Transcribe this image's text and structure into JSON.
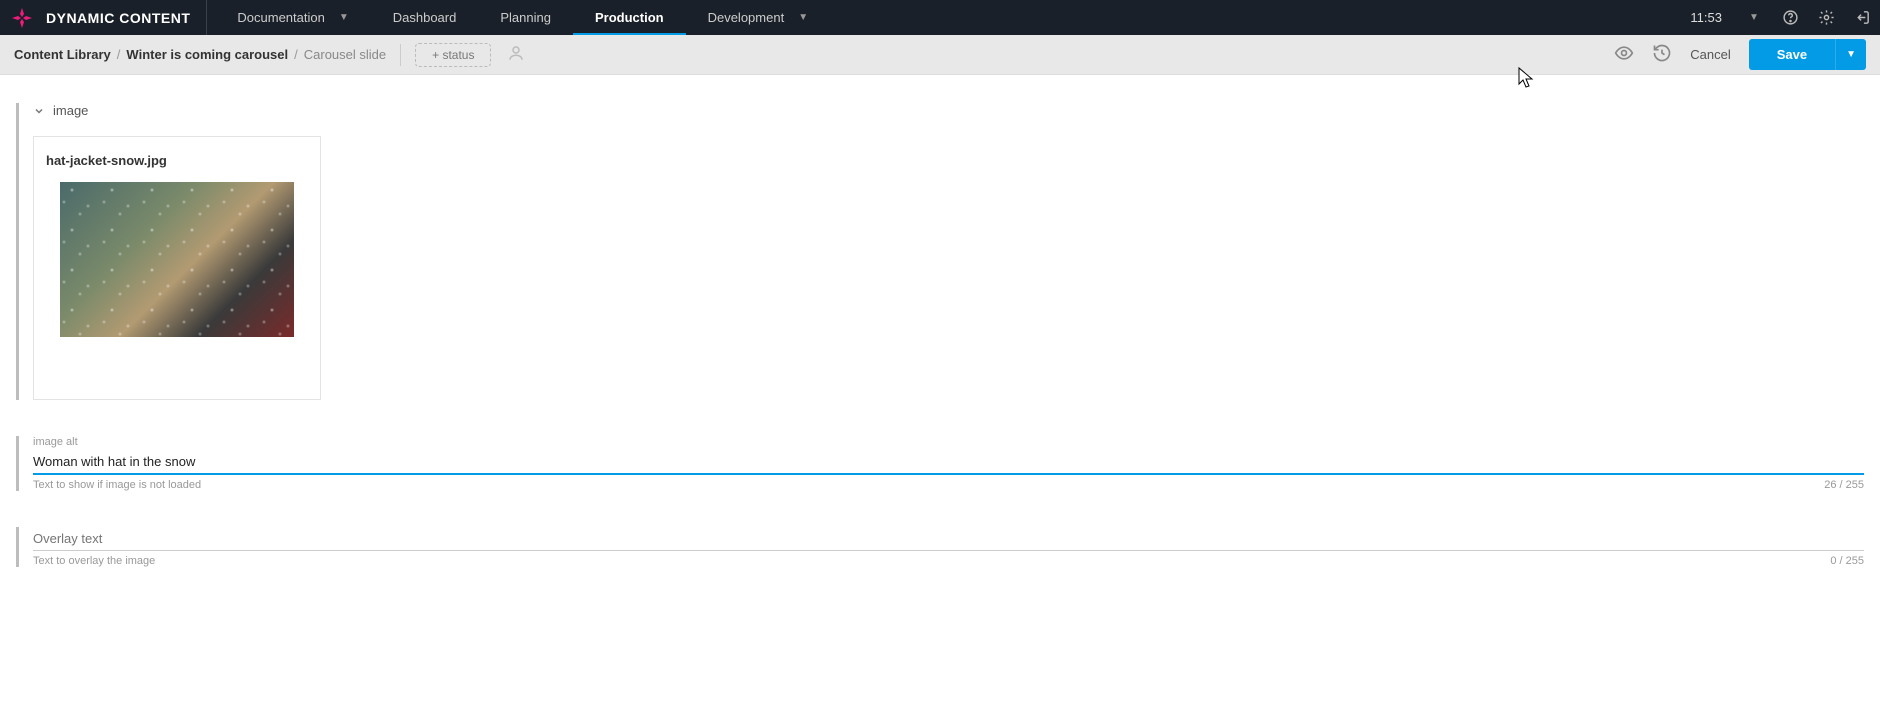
{
  "brand": "DYNAMIC CONTENT",
  "nav": {
    "documentation": "Documentation",
    "dashboard": "Dashboard",
    "planning": "Planning",
    "production": "Production",
    "development": "Development"
  },
  "clock": "11:53",
  "breadcrumb": {
    "root": "Content Library",
    "mid": "Winter is coming carousel",
    "leaf": "Carousel slide"
  },
  "status_button": "+ status",
  "actions": {
    "cancel": "Cancel",
    "save": "Save"
  },
  "sections": {
    "image": {
      "title": "image",
      "filename": "hat-jacket-snow.jpg"
    },
    "alt": {
      "label": "image alt",
      "value": "Woman with hat in the snow",
      "help": "Text to show if image is not loaded",
      "count": "26 / 255"
    },
    "overlay": {
      "placeholder": "Overlay text",
      "help": "Text to overlay the image",
      "count": "0 / 255"
    }
  }
}
